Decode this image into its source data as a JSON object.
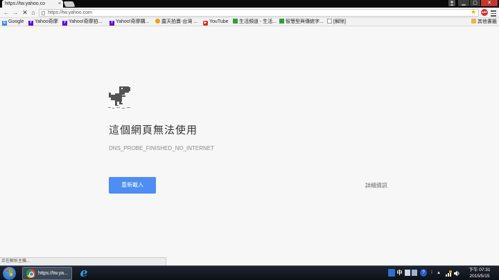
{
  "browser": {
    "tab_title": "https://tw.yahoo.co",
    "tab_close": "×",
    "url": "https://tw.yahoo.com",
    "window_minimize": "▁",
    "window_maximize": "▢",
    "window_close": "✕",
    "extension_label": "ABP"
  },
  "nav": {
    "back": "←",
    "forward": "→",
    "stop": "✕",
    "home": "⌂",
    "star": "★"
  },
  "bookmarks": [
    {
      "label": "Google",
      "icon": "google-icon"
    },
    {
      "label": "Yahoo奇摩",
      "icon": "yahoo-icon"
    },
    {
      "label": "Yahoo!奇摩拍...",
      "icon": "yahoo-icon"
    },
    {
      "label": "Yahoo!奇摩購...",
      "icon": "yahoo-icon"
    },
    {
      "label": "露天拍賣-台灣 ...",
      "icon": "ruten-icon"
    },
    {
      "label": "YouTube",
      "icon": "youtube-icon"
    },
    {
      "label": "生活頻道 - 生活...",
      "icon": "green-icon"
    },
    {
      "label": "智慧型與傳統字...",
      "icon": "green-icon"
    },
    {
      "label": "[解除]",
      "icon": "document-icon"
    },
    {
      "label": "其他書籤",
      "icon": "folder-icon"
    }
  ],
  "error_page": {
    "title": "這個網頁無法使用",
    "code": "DNS_PROBE_FINISHED_NO_INTERNET",
    "reload_label": "重新載入",
    "details_label": "詳細資訊"
  },
  "status_bar": {
    "text": "正在解析主機..."
  },
  "taskbar": {
    "chrome_label": "https://tw.ya...",
    "ie_glyph": "e",
    "ime_label": "中",
    "time": "下午 07:31",
    "date": "2015/5/15"
  },
  "colors": {
    "reload_button": "#4d8df4",
    "page_background": "#f7f7f7",
    "taskbar": "#141a22"
  }
}
